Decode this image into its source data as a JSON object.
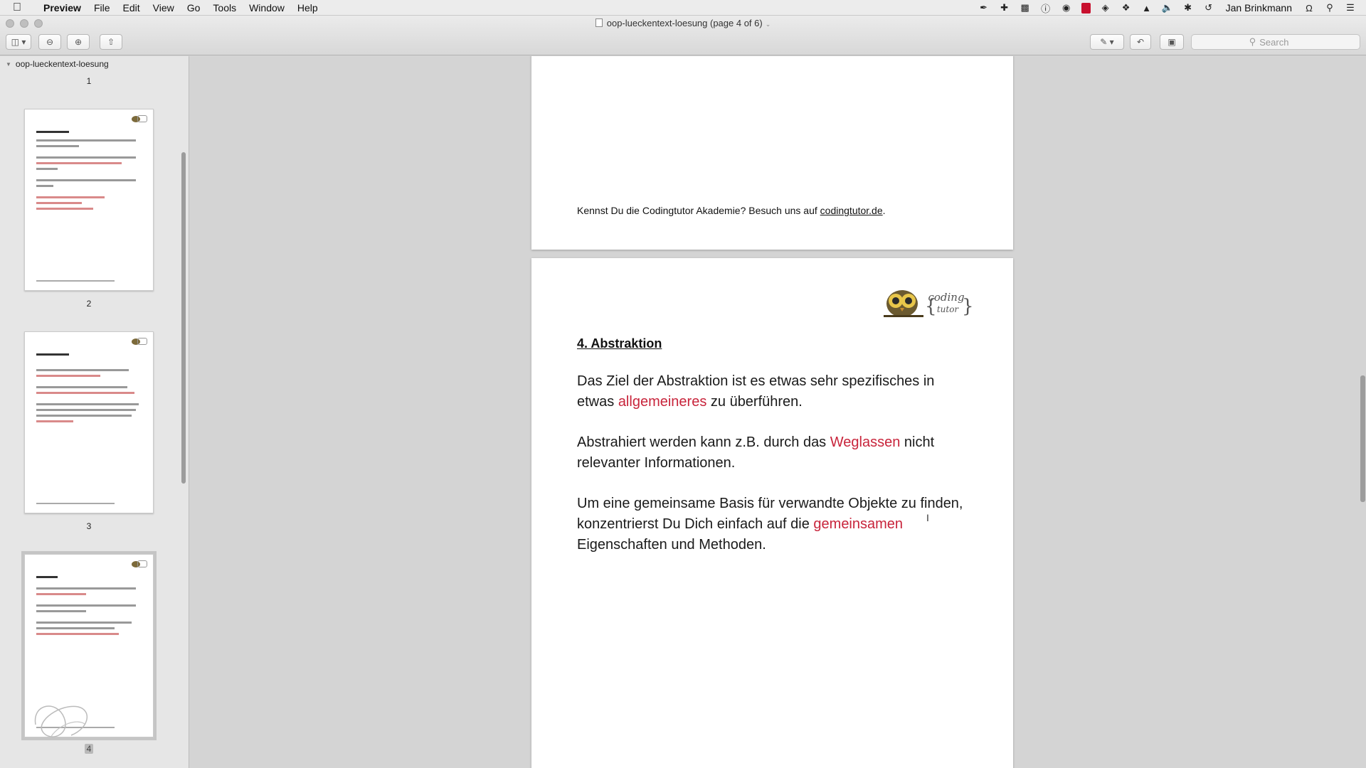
{
  "menubar": {
    "app_name": "Preview",
    "items": [
      "File",
      "Edit",
      "View",
      "Go",
      "Tools",
      "Window",
      "Help"
    ],
    "username": "Jan Brinkmann"
  },
  "window": {
    "title": "oop-lueckentext-loesung (page 4 of 6)"
  },
  "toolbar": {
    "search_placeholder": "Search"
  },
  "sidebar": {
    "document_name": "oop-lueckentext-loesung",
    "pages": [
      {
        "number": "1"
      },
      {
        "number": "2"
      },
      {
        "number": "3"
      },
      {
        "number": "4",
        "selected": true
      }
    ]
  },
  "page_prev": {
    "footer_text": "Kennst Du die Codingtutor Akademie? Besuch uns auf ",
    "footer_link": "codingtutor.de",
    "footer_end": "."
  },
  "page_current": {
    "logo_text_top": "coding",
    "logo_text_bottom": "tutor",
    "heading": "4. Abstraktion",
    "p1_a": "Das Ziel der Abstraktion ist es etwas sehr spezifisches in etwas ",
    "p1_red": "allgemeineres",
    "p1_b": " zu überführen.",
    "p2_a": "Abstrahiert werden kann z.B. durch das ",
    "p2_red": "Weglassen",
    "p2_b": " nicht relevanter Informationen.",
    "p3_a": "Um eine gemeinsame Basis für verwandte Objekte zu finden, konzentrierst Du Dich einfach auf die ",
    "p3_red": "gemeinsamen",
    "p3_b": " Eigenschaften und Methoden."
  },
  "colors": {
    "highlight_red": "#c8243b"
  }
}
